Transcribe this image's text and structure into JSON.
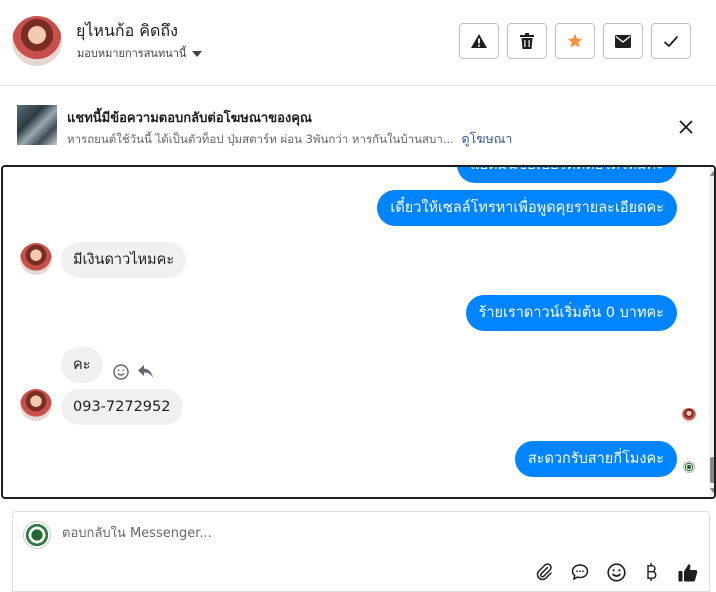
{
  "header": {
    "contact_name": "ยุไหนก้อ คิดถึง",
    "assignment_label": "มอบหมายการสนทนานี้",
    "actions": [
      {
        "name": "report-button",
        "icon": "warning-icon"
      },
      {
        "name": "delete-button",
        "icon": "trash-icon"
      },
      {
        "name": "star-button",
        "icon": "star-icon",
        "color": "#f7923b"
      },
      {
        "name": "mark-unread-button",
        "icon": "envelope-icon"
      },
      {
        "name": "mark-done-button",
        "icon": "check-icon"
      }
    ]
  },
  "ad": {
    "title": "แชทนี้มีข้อความตอบกลับต่อโฆษณาของคุณ",
    "description": "หารถยนต์ใช้วันนี้ ได้เป็นตัวท็อป ปุ่มสตาร์ท ผ่อน 3พันกว่า หารกันในบ้านสบา...",
    "link_label": "ดูโฆษณา"
  },
  "messages": [
    {
      "side": "out",
      "text": "แอดมินขอเบอร์ติดต่อได้ไหมคะ"
    },
    {
      "side": "out",
      "text": "เดี๋ยวให้เซลล์โทรหาเพื่อพูดคุยรายละเอียดคะ"
    },
    {
      "side": "in",
      "text": "มีเงินดาวไหมคะ"
    },
    {
      "side": "out",
      "text": "ร้ายเราดาวน์เริ่มต้น 0 บาทคะ"
    },
    {
      "side": "in",
      "text": "คะ"
    },
    {
      "side": "in",
      "text": "093-7272952"
    },
    {
      "side": "out",
      "text": "สะดวกรับสายกี่โมงคะ"
    }
  ],
  "composer": {
    "placeholder": "ตอบกลับใน Messenger...",
    "tools": [
      "paperclip-icon",
      "speech-bubble-icon",
      "emoji-icon",
      "baht-icon",
      "thumbs-up-icon"
    ]
  },
  "colors": {
    "outgoing_bubble": "#0084ff",
    "incoming_bubble": "#f0f0f0",
    "link": "#385898"
  }
}
